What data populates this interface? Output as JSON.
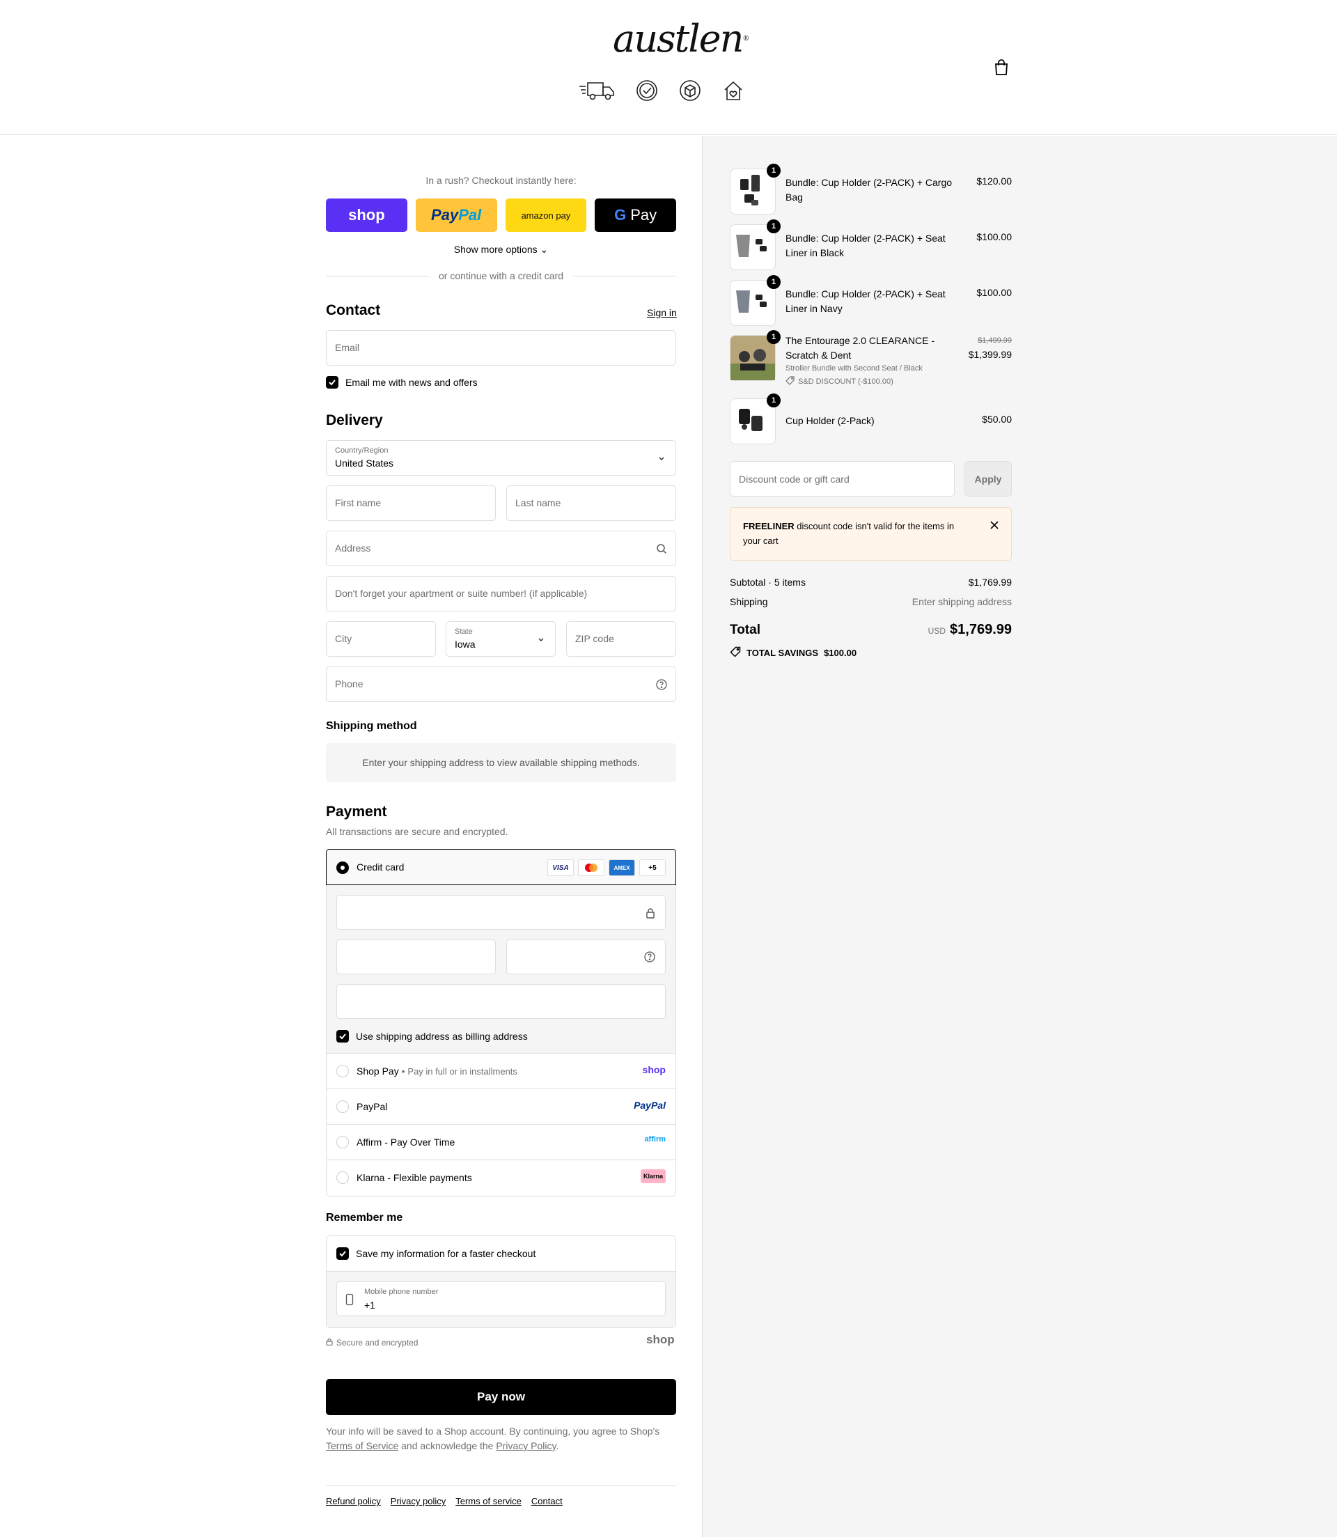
{
  "brand": {
    "logo_text": "austlen",
    "badges": [
      "truck-icon",
      "check-badge-icon",
      "box-icon",
      "home-heart-icon"
    ]
  },
  "express": {
    "heading": "In a rush? Checkout instantly here:",
    "shop": "shop",
    "paypal_a": "Pay",
    "paypal_b": "Pal",
    "amazon": "amazon pay",
    "gpay_g": "G",
    "gpay": "Pay",
    "more_options": "Show more options",
    "or_text": "or continue with a credit card"
  },
  "contact": {
    "title": "Contact",
    "sign_in": "Sign in",
    "email_placeholder": "Email",
    "news_label": "Email me with news and offers"
  },
  "delivery": {
    "title": "Delivery",
    "country_label": "Country/Region",
    "country_value": "United States",
    "first_name": "First name",
    "last_name": "Last name",
    "address": "Address",
    "apt": "Don't forget your apartment or suite number! (if applicable)",
    "city": "City",
    "state_label": "State",
    "state_value": "Iowa",
    "zip": "ZIP code",
    "phone": "Phone"
  },
  "shipping": {
    "title": "Shipping method",
    "note": "Enter your shipping address to view available shipping methods."
  },
  "payment": {
    "title": "Payment",
    "subtitle": "All transactions are secure and encrypted.",
    "credit_card": "Credit card",
    "card_brands": [
      "VISA",
      "MC",
      "AMEX",
      "+5"
    ],
    "billing_same": "Use shipping address as billing address",
    "options": [
      {
        "label": "Shop Pay",
        "sub": "Pay in full or in installments",
        "logo": "shop"
      },
      {
        "label": "PayPal",
        "sub": "",
        "logo": "PayPal"
      },
      {
        "label": "Affirm - Pay Over Time",
        "sub": "",
        "logo": "affirm"
      },
      {
        "label": "Klarna - Flexible payments",
        "sub": "",
        "logo": "Klarna"
      }
    ]
  },
  "remember": {
    "title": "Remember me",
    "save_label": "Save my information for a faster checkout",
    "mobile_label": "Mobile phone number",
    "mobile_value": "+1",
    "secure": "Secure and encrypted",
    "shop_logo": "shop"
  },
  "pay_now": "Pay now",
  "legal": {
    "text_a": "Your info will be saved to a Shop account. By continuing, you agree to Shop's",
    "terms": "Terms of Service",
    "text_b": "and acknowledge the",
    "privacy": "Privacy Policy",
    "text_c": "."
  },
  "footer": [
    "Refund policy",
    "Privacy policy",
    "Terms of service",
    "Contact"
  ],
  "cart": {
    "items": [
      {
        "name": "Bundle: Cup Holder (2-PACK) + Cargo Bag",
        "price": "$120.00",
        "qty": "1"
      },
      {
        "name": "Bundle: Cup Holder (2-PACK) + Seat Liner in Black",
        "price": "$100.00",
        "qty": "1"
      },
      {
        "name": "Bundle: Cup Holder (2-PACK) + Seat Liner in Navy",
        "price": "$100.00",
        "qty": "1"
      },
      {
        "name": "The Entourage 2.0 CLEARANCE - Scratch & Dent",
        "variant": "Stroller Bundle with Second Seat / Black",
        "discount": "S&D DISCOUNT (-$100.00)",
        "old_price": "$1,499.99",
        "price": "$1,399.99",
        "qty": "1"
      },
      {
        "name": "Cup Holder (2-Pack)",
        "price": "$50.00",
        "qty": "1"
      }
    ],
    "discount_placeholder": "Discount code or gift card",
    "apply": "Apply",
    "alert_code": "FREELINER",
    "alert_text": "discount code isn't valid for the items in your cart",
    "subtotal_label": "Subtotal · 5 items",
    "subtotal": "$1,769.99",
    "shipping_label": "Shipping",
    "shipping_value": "Enter shipping address",
    "total_label": "Total",
    "currency": "USD",
    "total": "$1,769.99",
    "savings_label": "TOTAL SAVINGS",
    "savings": "$100.00"
  }
}
